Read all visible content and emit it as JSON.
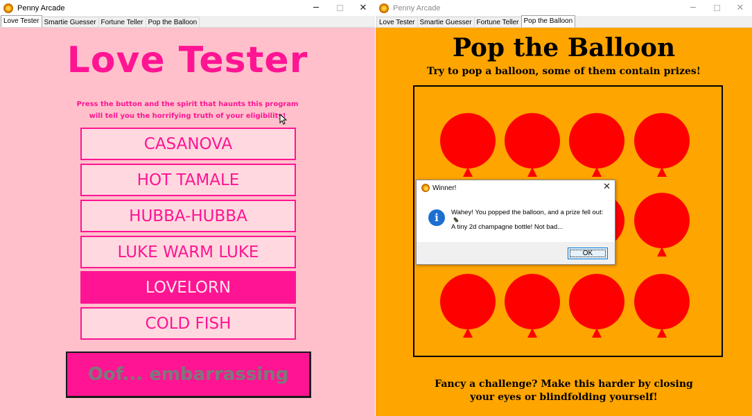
{
  "left_window": {
    "title": "Penny Arcade",
    "controls": {
      "minimize": "─",
      "close": "✕"
    },
    "tabs": [
      "Love Tester",
      "Smartie Guesser",
      "Fortune Teller",
      "Pop the Balloon"
    ],
    "active_tab": "Love Tester",
    "love_tester": {
      "title": "Love Tester",
      "instructions_line1": "Press the button and the spirit that haunts this program",
      "instructions_line2": "will tell you the horrifying truth of your eligibility!",
      "options": [
        "CASANOVA",
        "HOT TAMALE",
        "HUBBA-HUBBA",
        "LUKE WARM LUKE",
        "LOVELORN",
        "COLD FISH"
      ],
      "selected_option": "LOVELORN",
      "result_button": "Oof... embarrassing",
      "colors": {
        "background": "#ffc0cb",
        "accent": "#ff1493"
      }
    }
  },
  "right_window": {
    "title": "Penny Arcade",
    "controls": {
      "minimize": "─",
      "close": "✕"
    },
    "tabs": [
      "Love Tester",
      "Smartie Guesser",
      "Fortune Teller",
      "Pop the Balloon"
    ],
    "active_tab": "Pop the Balloon",
    "pop_the_balloon": {
      "title": "Pop the Balloon",
      "subtitle": "Try to pop a balloon, some of them contain prizes!",
      "footer_line1": "Fancy a challenge? Make this harder by closing",
      "footer_line2": "your eyes or blindfolding yourself!",
      "balloon_rows": 3,
      "balloon_cols": 4,
      "colors": {
        "background": "#ffa500",
        "balloon": "#ff0000"
      }
    }
  },
  "dialog": {
    "title": "Winner!",
    "close": "✕",
    "icon": "info-icon",
    "message_line1": "Wahey! You popped the balloon, and a prize fell out:",
    "prize_icon": "champagne-bottle-icon",
    "message_line2": "A tiny 2d champagne bottle! Not bad...",
    "ok_label": "OK"
  }
}
